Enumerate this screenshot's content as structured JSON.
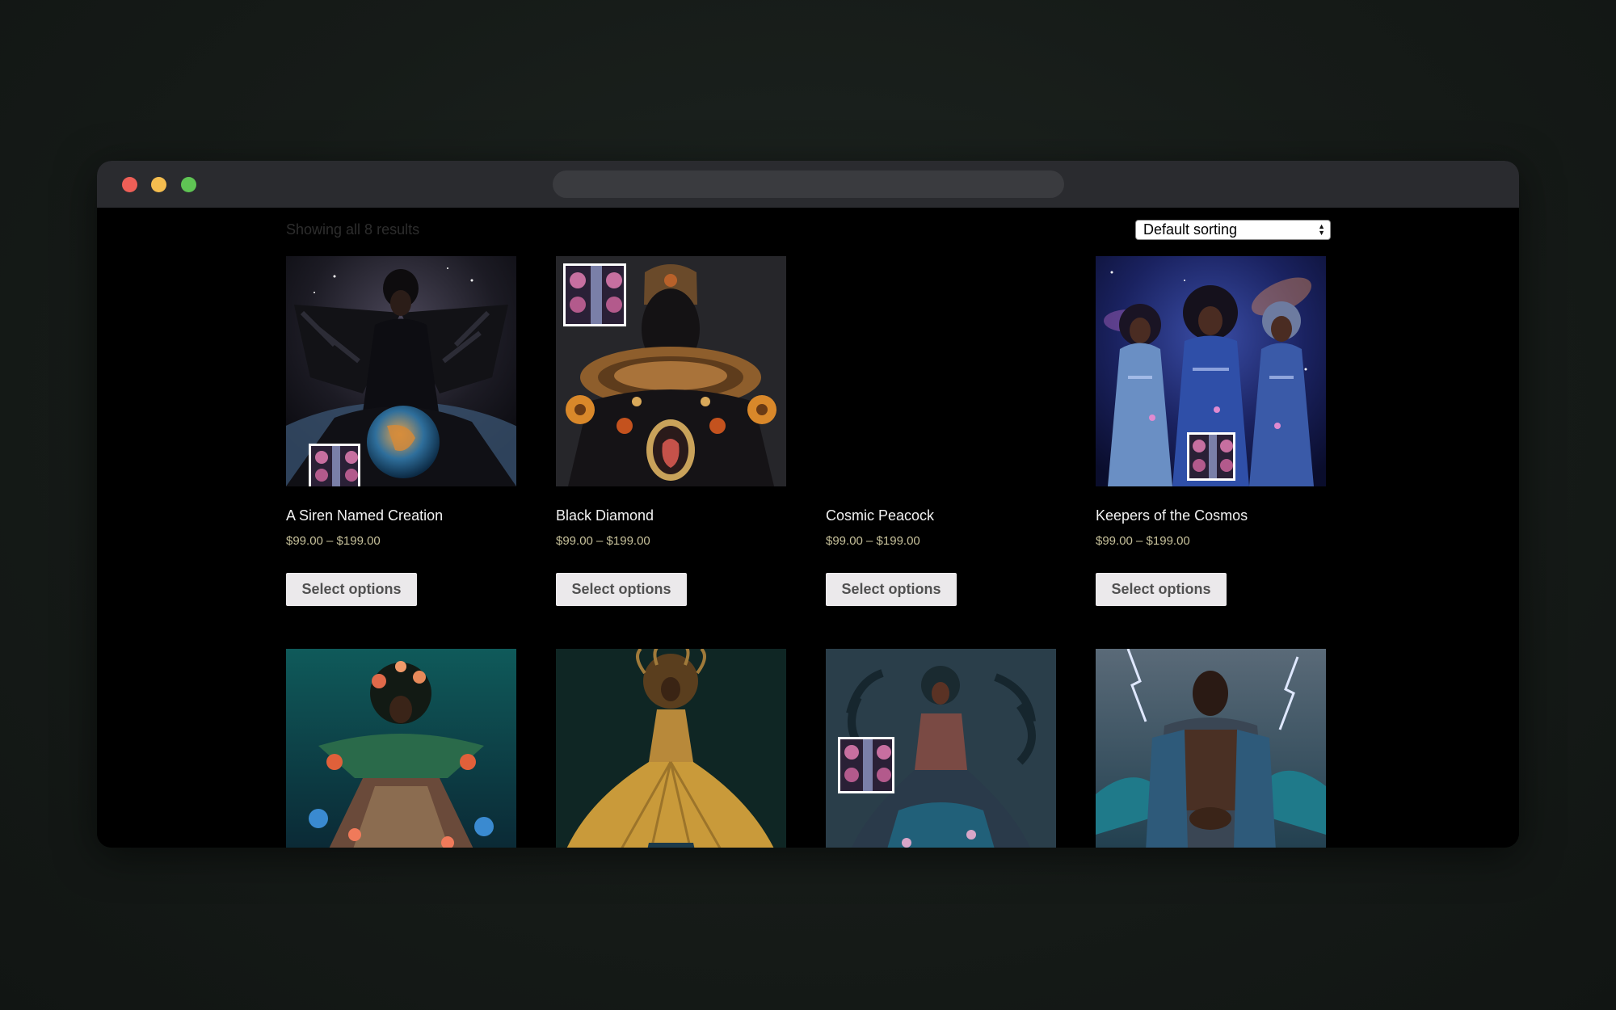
{
  "shop": {
    "result_count": "Showing all 8 results",
    "sorting": {
      "selected": "Default sorting"
    }
  },
  "products": [
    {
      "title": "A Siren Named Creation",
      "price": "$99.00 – $199.00",
      "button": "Select options",
      "image_visible": true
    },
    {
      "title": "Black Diamond",
      "price": "$99.00 – $199.00",
      "button": "Select options",
      "image_visible": true
    },
    {
      "title": "Cosmic Peacock",
      "price": "$99.00 – $199.00",
      "button": "Select options",
      "image_visible": false
    },
    {
      "title": "Keepers of the Cosmos",
      "price": "$99.00 – $199.00",
      "button": "Select options",
      "image_visible": true
    },
    {
      "image_visible": true
    },
    {
      "image_visible": true
    },
    {
      "image_visible": true
    },
    {
      "image_visible": true
    }
  ],
  "colors": {
    "price": "#c6c09a",
    "button_bg": "#ebe9eb",
    "button_text": "#515151",
    "page_bg": "#000000"
  }
}
